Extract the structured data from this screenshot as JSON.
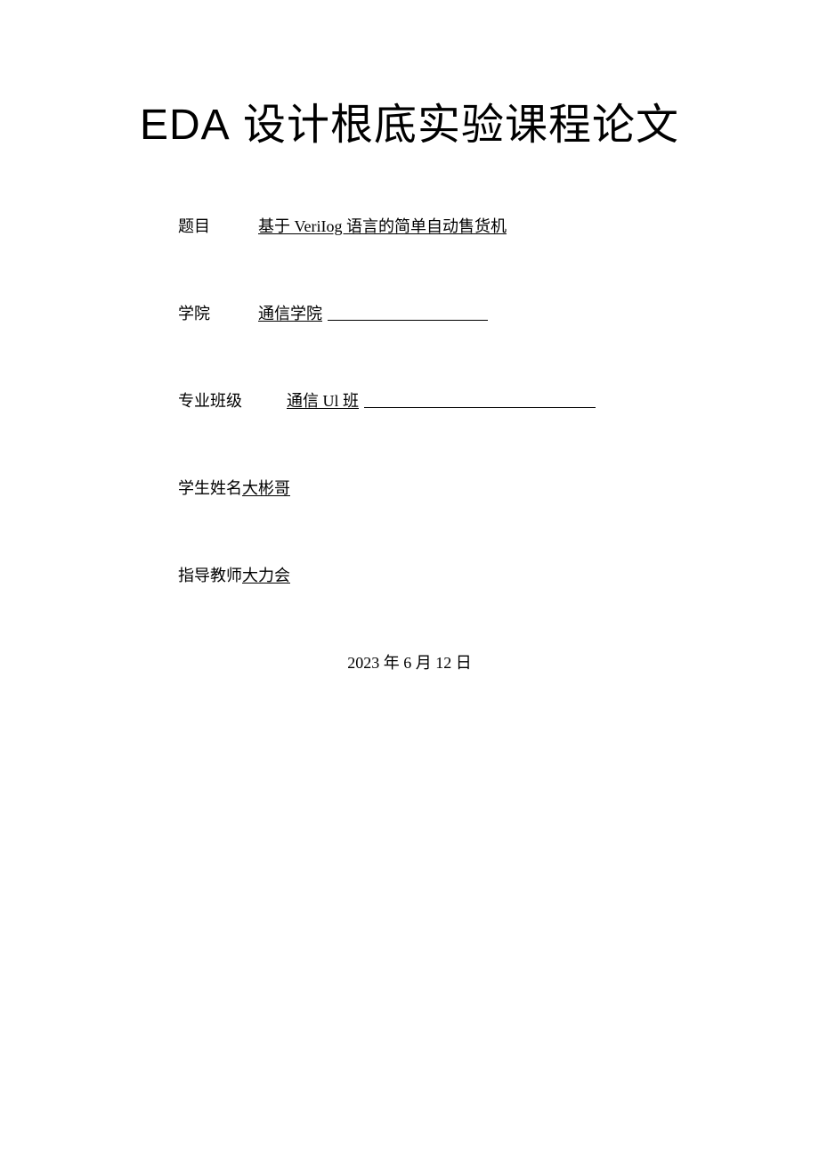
{
  "title": {
    "prefix": "EDA",
    "rest": " 设计根底实验课程论文"
  },
  "fields": {
    "topic": {
      "label": "题目",
      "value": "基于 VeriIog 语言的简单自动售货机"
    },
    "college": {
      "label": "学院",
      "value": "通信学院"
    },
    "major": {
      "label": "专业班级",
      "value": "通信 Ul 班"
    },
    "student": {
      "label": "学生姓名",
      "value": "大彬哥"
    },
    "advisor": {
      "label": "指导教师",
      "value": "大力会"
    }
  },
  "date": "2023 年 6 月 12 日"
}
